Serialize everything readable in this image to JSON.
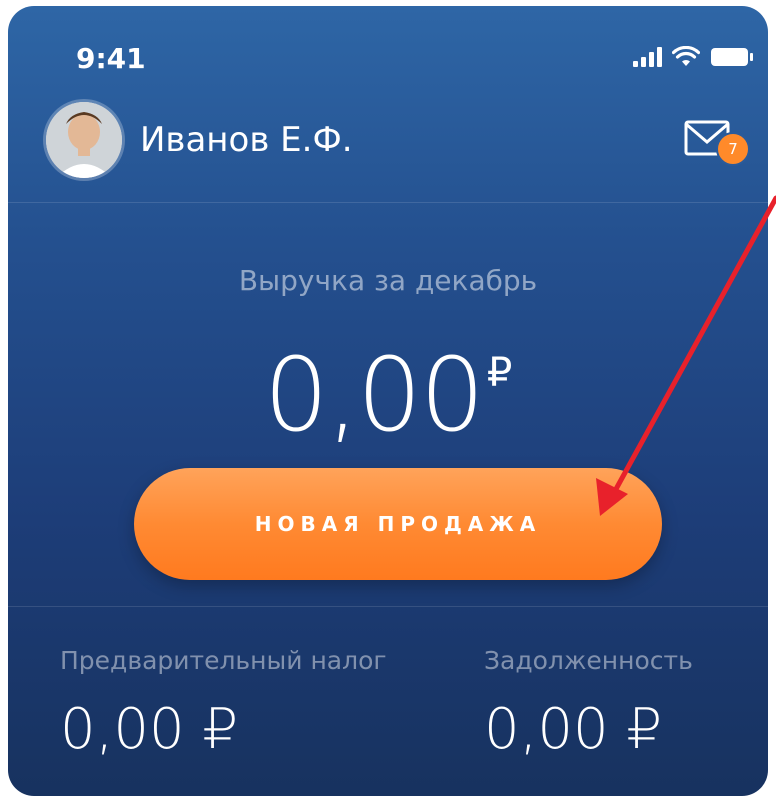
{
  "status_bar": {
    "time": "9:41",
    "icons": [
      "signal-icon",
      "wifi-icon",
      "battery-icon"
    ]
  },
  "header": {
    "user_name": "Иванов Е.Ф.",
    "mail_badge_count": "7",
    "icons": [
      "avatar",
      "mail-icon"
    ]
  },
  "revenue": {
    "label": "Выручка за декабрь",
    "amount": "0,00",
    "currency": "₽"
  },
  "actions": {
    "new_sale_label": "НОВАЯ ПРОДАЖА"
  },
  "stats": {
    "tax_label": "Предварительный налог",
    "tax_value": "0,00 ₽",
    "debt_label": "Задолженность",
    "debt_value": "0,00 ₽"
  },
  "colors": {
    "background_top": "#2e66a6",
    "background_bottom": "#17325f",
    "accent": "#ff8a33",
    "annotation_arrow": "#e8212b"
  }
}
